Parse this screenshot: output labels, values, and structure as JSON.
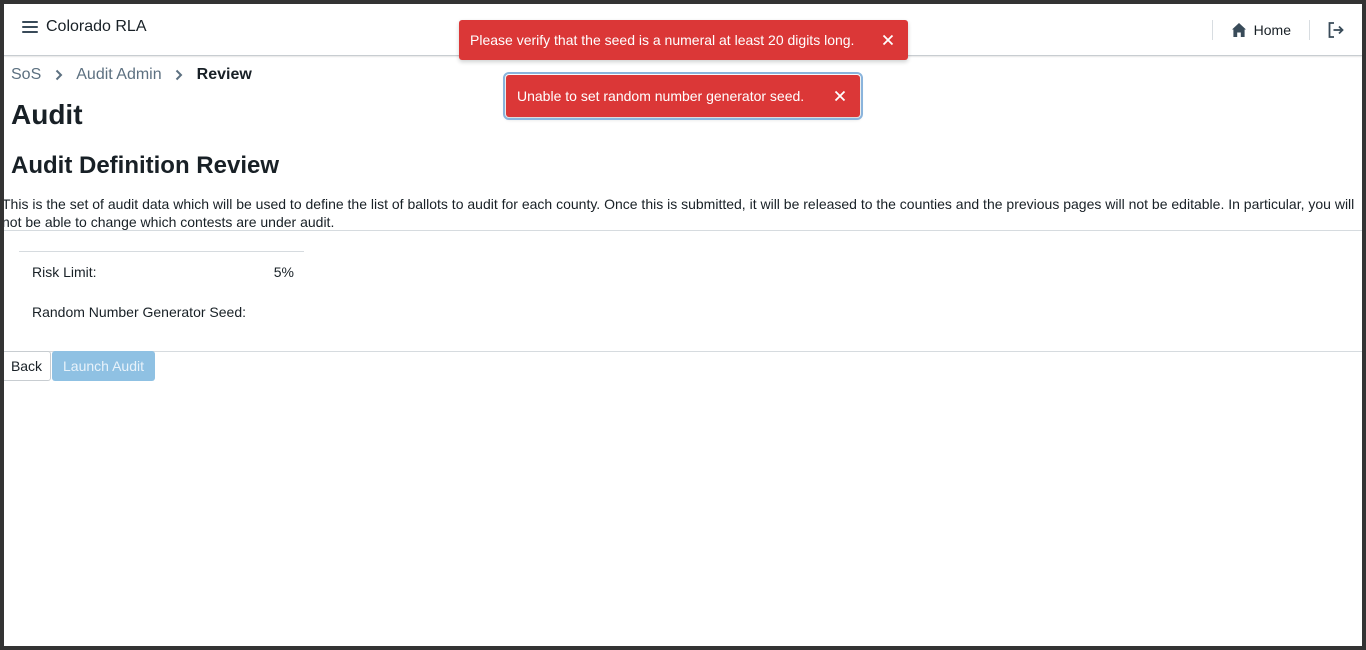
{
  "app": {
    "title": "Colorado RLA"
  },
  "nav": {
    "home_label": "Home"
  },
  "breadcrumb": {
    "items": [
      "SoS",
      "Audit Admin",
      "Review"
    ]
  },
  "page": {
    "title": "Audit",
    "section_title": "Audit Definition Review",
    "description": "This is the set of audit data which will be used to define the list of ballots to audit for each county. Once this is submitted, it will be released to the counties and the previous pages will not be editable. In particular, you will not be able to change which contests are under audit."
  },
  "summary": {
    "risk_limit_label": "Risk Limit:",
    "risk_limit_value": "5%",
    "seed_label": "Random Number Generator Seed:",
    "seed_value": ""
  },
  "actions": {
    "back_label": "Back",
    "launch_label": "Launch Audit"
  },
  "toasts": [
    {
      "message": "Please verify that the seed is a numeral at least 20 digits long."
    },
    {
      "message": "Unable to set random number generator seed."
    }
  ],
  "colors": {
    "toast_danger": "#db3737",
    "launch_disabled": "#8fc1e3"
  }
}
